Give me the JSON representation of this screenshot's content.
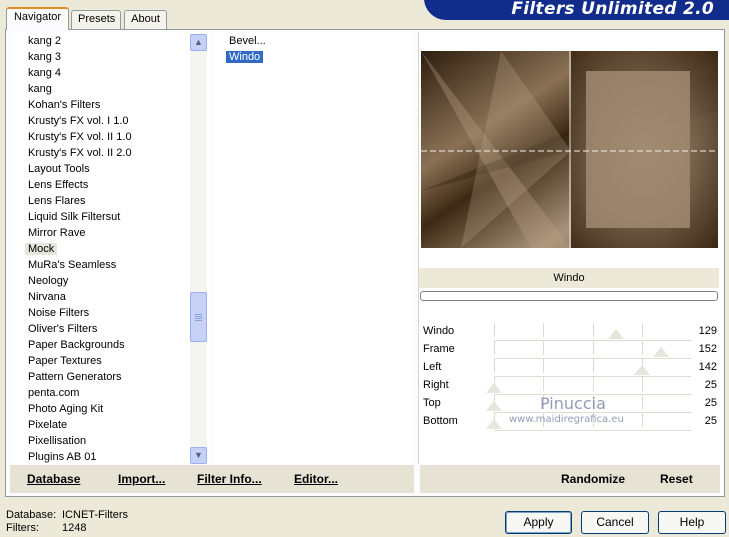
{
  "tabs": [
    "Navigator",
    "Presets",
    "About"
  ],
  "title": "Filters Unlimited 2.0",
  "categories": [
    "kang 2",
    "kang 3",
    "kang 4",
    "kang",
    "Kohan's Filters",
    "Krusty's FX vol. I 1.0",
    "Krusty's FX vol. II 1.0",
    "Krusty's FX vol. II 2.0",
    "Layout Tools",
    "Lens Effects",
    "Lens Flares",
    "Liquid Silk Filtersut",
    "Mirror Rave",
    "Mock",
    "MuRa's Seamless",
    "Neology",
    "Nirvana",
    "Noise Filters",
    "Oliver's Filters",
    "Paper Backgrounds",
    "Paper Textures",
    "Pattern Generators",
    "penta.com",
    "Photo Aging Kit",
    "Pixelate",
    "Pixellisation",
    "Plugins AB 01"
  ],
  "selected_category": "Mock",
  "filters": [
    "Bevel...",
    "Windo"
  ],
  "selected_filter": "Windo",
  "filter_name": "Windo",
  "parameters": [
    {
      "label": "Windo",
      "value": "129"
    },
    {
      "label": "Frame",
      "value": "152"
    },
    {
      "label": "Left",
      "value": "142"
    },
    {
      "label": "Right",
      "value": "25"
    },
    {
      "label": "Top",
      "value": "25"
    },
    {
      "label": "Bottom",
      "value": "25"
    }
  ],
  "watermark": {
    "line1": "Pinuccia",
    "line2": "www.maidiregrafica.eu"
  },
  "bottom_left_buttons": [
    "Database",
    "Import...",
    "Filter Info...",
    "Editor..."
  ],
  "bottom_right_buttons": [
    "Randomize",
    "Reset"
  ],
  "status": {
    "database_label": "Database:",
    "database_value": "ICNET-Filters",
    "filters_label": "Filters:",
    "filters_value": "1248"
  },
  "actions": {
    "apply": "Apply",
    "cancel": "Cancel",
    "help": "Help"
  },
  "colors": {
    "accent": "#316ac5",
    "banner": "#112c8a",
    "preview_dark": "#3e2a14",
    "preview_light": "#a8937a"
  }
}
